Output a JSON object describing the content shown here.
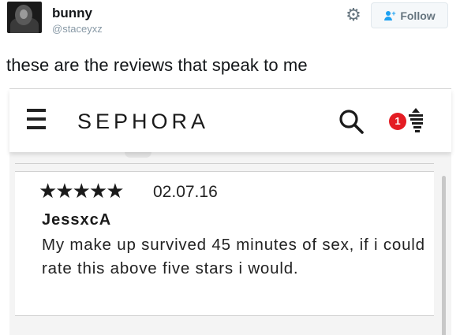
{
  "tweet": {
    "display_name": "bunny",
    "handle": "@staceyxz",
    "text": "these are the reviews that speak to me",
    "follow_label": "Follow"
  },
  "icons": {
    "settings": "gear-icon",
    "follow": "add-user-icon",
    "menu": "hamburger-icon",
    "search": "search-icon",
    "bag": "shopping-bag-icon"
  },
  "sephora": {
    "brand": "SEPHORA",
    "cart_count": "1"
  },
  "review": {
    "stars": "★★★★★",
    "rating": 5,
    "date": "02.07.16",
    "reviewer": "JessxcA",
    "text": "My make up survived 45 minutes of sex, if i could rate this above five stars i would."
  },
  "colors": {
    "badge": "#e41c23",
    "twitter_blue": "#1da1f2",
    "handle_gray": "#8899a6"
  }
}
